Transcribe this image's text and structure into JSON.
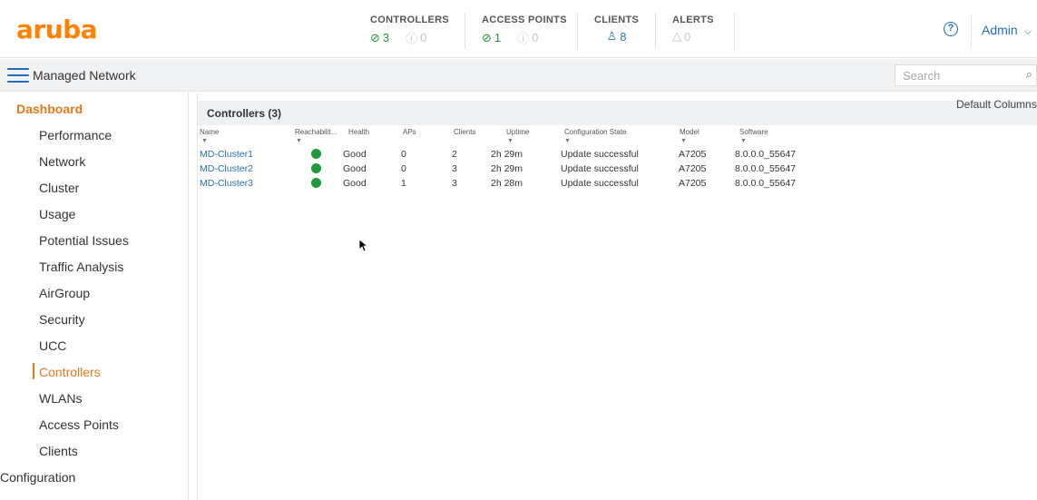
{
  "brand": {
    "logo_text": "aruba",
    "color": "#ff8300"
  },
  "header": {
    "stats": [
      {
        "title": "CONTROLLERS",
        "ok_count": "3",
        "warn_count": "0"
      },
      {
        "title": "ACCESS POINTS",
        "ok_count": "1",
        "warn_count": "0"
      },
      {
        "title": "CLIENTS",
        "count": "8"
      },
      {
        "title": "ALERTS",
        "count": "0"
      }
    ],
    "help_label": "?",
    "user_menu": "Admin"
  },
  "subbar": {
    "title": "Managed Network",
    "search_placeholder": "Search"
  },
  "sidebar": {
    "items": [
      {
        "label": "Dashboard",
        "state": "active-parent"
      },
      {
        "label": "Performance"
      },
      {
        "label": "Network"
      },
      {
        "label": "Cluster"
      },
      {
        "label": "Usage"
      },
      {
        "label": "Potential Issues"
      },
      {
        "label": "Traffic Analysis"
      },
      {
        "label": "AirGroup"
      },
      {
        "label": "Security"
      },
      {
        "label": "UCC"
      },
      {
        "label": "Controllers",
        "state": "active"
      },
      {
        "label": "WLANs"
      },
      {
        "label": "Access Points"
      },
      {
        "label": "Clients"
      },
      {
        "label": "Configuration"
      }
    ]
  },
  "main": {
    "default_columns_label": "Default Columns",
    "table_title": "Controllers (3)",
    "columns": [
      "Name",
      "Reachabilit...",
      "Health",
      "APs",
      "Clients",
      "Uptime",
      "Configuration State",
      "Model",
      "Software"
    ],
    "rows": [
      {
        "name": "MD-Cluster1",
        "health": "Good",
        "aps": "0",
        "clients": "2",
        "uptime": "2h 29m",
        "config_state": "Update successful",
        "model": "A7205",
        "software": "8.0.0.0_55647"
      },
      {
        "name": "MD-Cluster2",
        "health": "Good",
        "aps": "0",
        "clients": "3",
        "uptime": "2h 29m",
        "config_state": "Update successful",
        "model": "A7205",
        "software": "8.0.0.0_55647"
      },
      {
        "name": "MD-Cluster3",
        "health": "Good",
        "aps": "1",
        "clients": "3",
        "uptime": "2h 28m",
        "config_state": "Update successful",
        "model": "A7205",
        "software": "8.0.0.0_55647"
      }
    ],
    "reachability_color": "#1f9a3a"
  }
}
